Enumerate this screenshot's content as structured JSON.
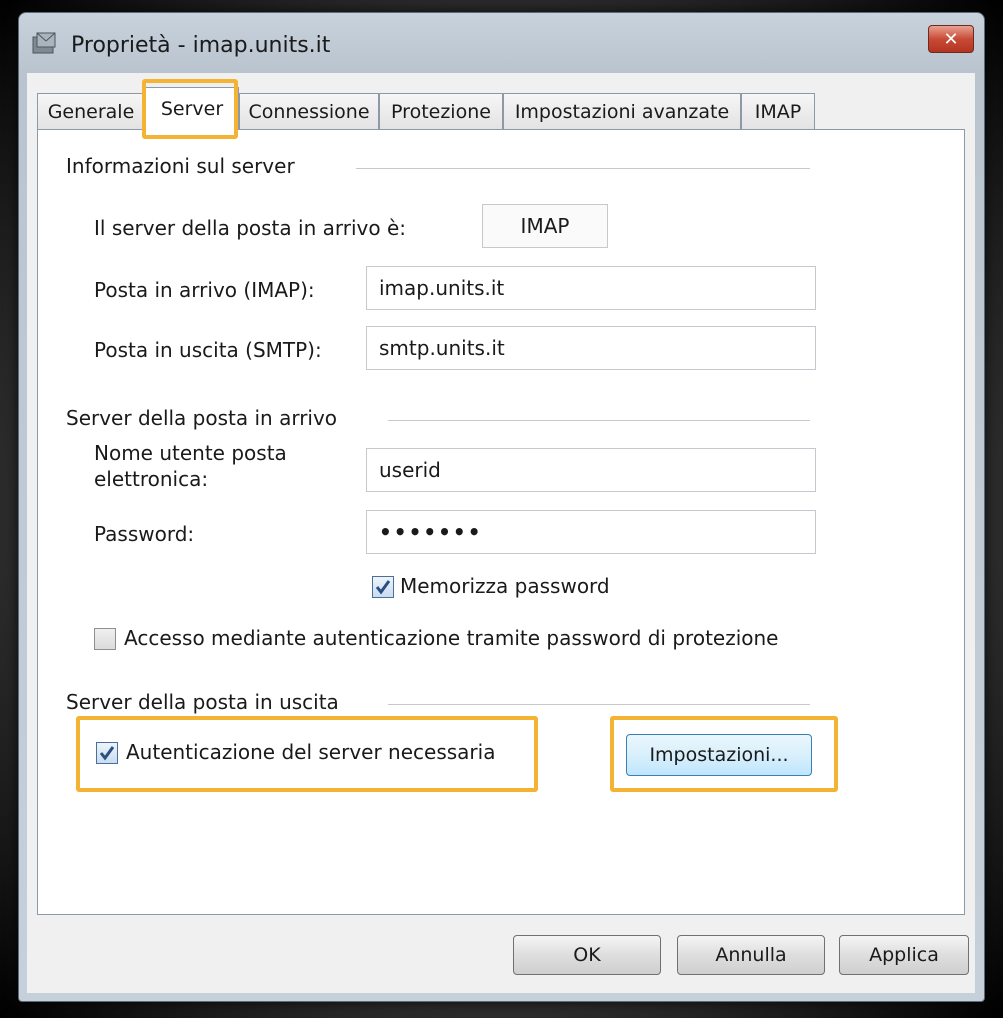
{
  "window": {
    "title": "Proprietà - imap.units.it",
    "close_glyph": "✕",
    "icon": "mail-account-icon"
  },
  "tabs": [
    {
      "label": "Generale"
    },
    {
      "label": "Server"
    },
    {
      "label": "Connessione"
    },
    {
      "label": "Protezione"
    },
    {
      "label": "Impostazioni avanzate"
    },
    {
      "label": "IMAP"
    }
  ],
  "active_tab": "Server",
  "server_info": {
    "title": "Informazioni sul server",
    "incoming_type_label": "Il server della posta in arrivo è:",
    "incoming_type_value": "IMAP",
    "incoming_label": "Posta in arrivo (IMAP):",
    "incoming_value": "imap.units.it",
    "outgoing_label": "Posta in uscita (SMTP):",
    "outgoing_value": "smtp.units.it"
  },
  "incoming_server": {
    "title": "Server della posta in arrivo",
    "username_label": "Nome utente posta\nelettronica:",
    "username_value": "userid",
    "password_label": "Password:",
    "password_value": "•••••••",
    "remember_label": "Memorizza password",
    "remember_checked": true,
    "spa_label": "Accesso mediante autenticazione tramite password di protezione",
    "spa_checked": false
  },
  "outgoing_server": {
    "title": "Server della posta in uscita",
    "auth_label": "Autenticazione del server necessaria",
    "auth_checked": true,
    "settings_button": "Impostazioni..."
  },
  "footer": {
    "ok": "OK",
    "cancel": "Annulla",
    "apply": "Applica"
  },
  "colors": {
    "highlight": "#f4b333",
    "check": "#2b4f82"
  }
}
